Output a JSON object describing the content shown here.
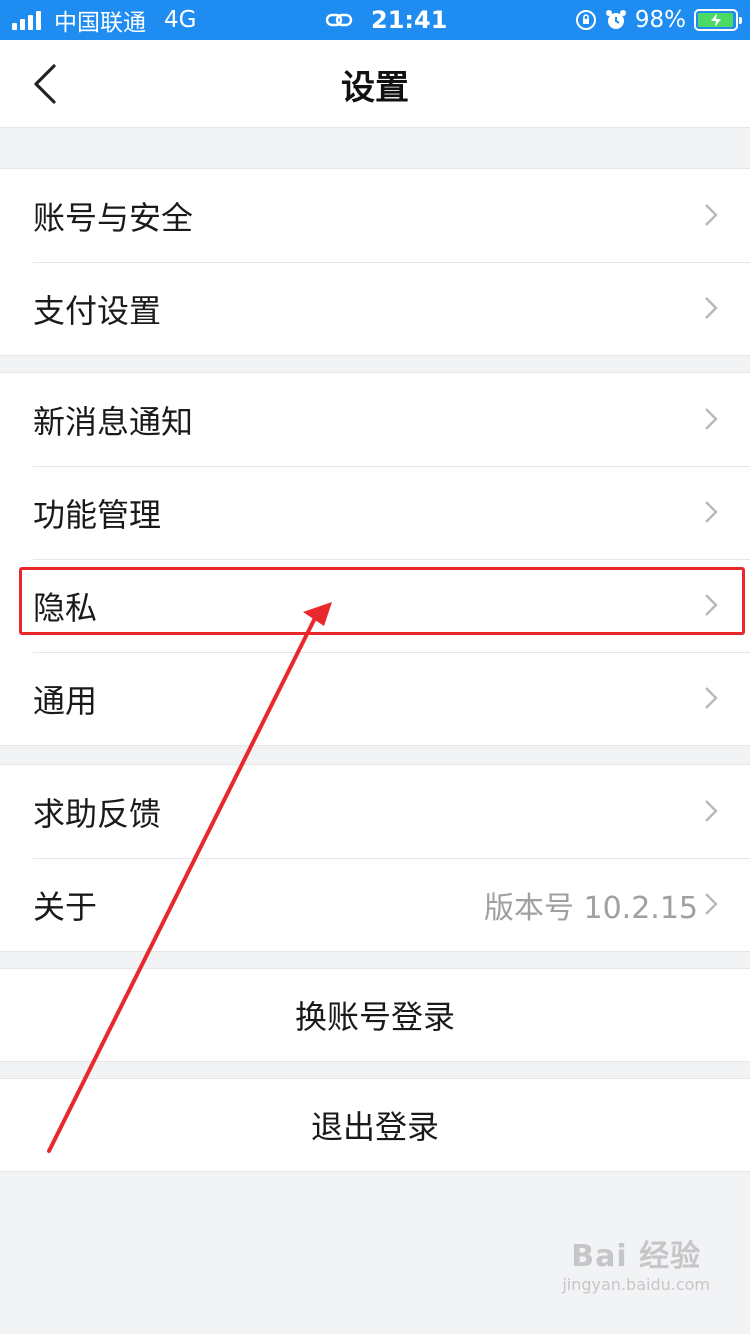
{
  "status_bar": {
    "carrier": "中国联通",
    "network": "4G",
    "time": "21:41",
    "battery": "98%",
    "battery_level": 0.98,
    "icons": [
      "signal-icon",
      "link-icon",
      "rotation-lock-icon",
      "alarm-icon",
      "battery-charging-icon"
    ]
  },
  "nav": {
    "title": "设置",
    "back_icon": "chevron-left-icon"
  },
  "groups": [
    {
      "items": [
        {
          "label": "账号与安全"
        },
        {
          "label": "支付设置"
        }
      ]
    },
    {
      "items": [
        {
          "label": "新消息通知"
        },
        {
          "label": "功能管理"
        },
        {
          "label": "隐私"
        },
        {
          "label": "通用"
        }
      ]
    },
    {
      "items": [
        {
          "label": "求助反馈"
        },
        {
          "label": "关于",
          "value": "版本号 10.2.15"
        }
      ]
    }
  ],
  "actions": {
    "switch_account": "换账号登录",
    "logout": "退出登录"
  },
  "annotation": {
    "highlighted_item": "隐私",
    "color": "#e8282b"
  },
  "watermark": {
    "text": "Bai 经验",
    "sub": "jingyan.baidu.com"
  },
  "colors": {
    "status_bar": "#1e8cf0",
    "background": "#f2f3f5",
    "accent_red": "#e8282b"
  }
}
